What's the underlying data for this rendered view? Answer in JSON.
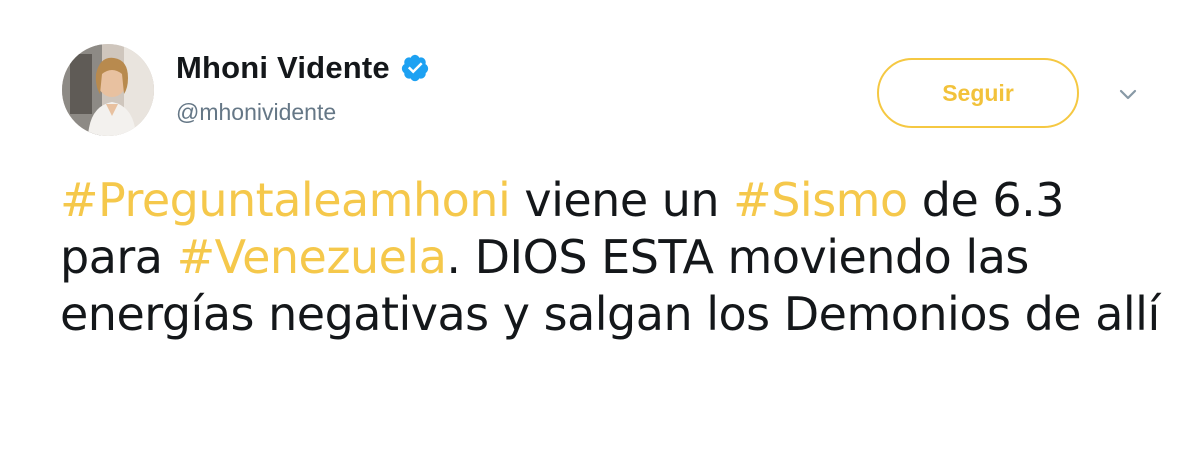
{
  "user": {
    "display_name": "Mhoni Vidente",
    "handle": "@mhonividente",
    "verified": true,
    "avatar_icon": "profile-photo"
  },
  "actions": {
    "follow_label": "Seguir",
    "menu_icon": "chevron-down-icon"
  },
  "tweet": {
    "segments": [
      {
        "type": "hashtag",
        "text": "#Preguntaleamhoni"
      },
      {
        "type": "text",
        "text": " viene un "
      },
      {
        "type": "hashtag",
        "text": "#Sismo"
      },
      {
        "type": "text",
        "text": " de 6.3 para "
      },
      {
        "type": "hashtag",
        "text": "#Venezuela"
      },
      {
        "type": "text",
        "text": ". DIOS ESTA moviendo las energías negativas y salgan los Demonios de allí"
      }
    ]
  },
  "colors": {
    "accent": "#f5c84b",
    "verified_badge": "#1da1f2",
    "text_primary": "#14171a",
    "text_secondary": "#657786"
  }
}
